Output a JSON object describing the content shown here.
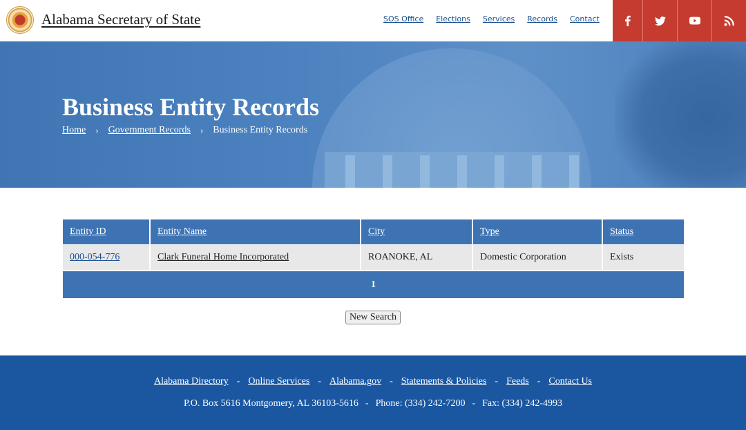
{
  "header": {
    "title": "Alabama Secretary of State",
    "nav": [
      "SOS Office",
      "Elections",
      "Services",
      "Records",
      "Contact"
    ],
    "social_icons": [
      "facebook-icon",
      "twitter-icon",
      "youtube-icon",
      "rss-icon"
    ]
  },
  "hero": {
    "title": "Business Entity Records",
    "breadcrumbs": [
      "Home",
      "Government Records",
      "Business Entity Records"
    ]
  },
  "table": {
    "headers": [
      "Entity ID",
      "Entity Name",
      "City",
      "Type",
      "Status"
    ],
    "rows": [
      [
        "000-054-776",
        "Clark Funeral Home Incorporated",
        "ROANOKE, AL",
        "Domestic Corporation",
        "Exists"
      ]
    ],
    "page": "1"
  },
  "new_search_label": "New Search",
  "footer": {
    "links": [
      "Alabama Directory",
      "Online Services",
      "Alabama.gov",
      "Statements & Policies",
      "Feeds",
      "Contact Us"
    ],
    "separator": "-",
    "address": "P.O. Box 5616 Montgomery, AL 36103-5616",
    "phone": "Phone: (334) 242-7200",
    "fax": "Fax: (334) 242-4993"
  },
  "colors": {
    "accent_blue": "#3d73b3",
    "footer_blue": "#1b57a1",
    "social_red": "#c53b2f"
  }
}
